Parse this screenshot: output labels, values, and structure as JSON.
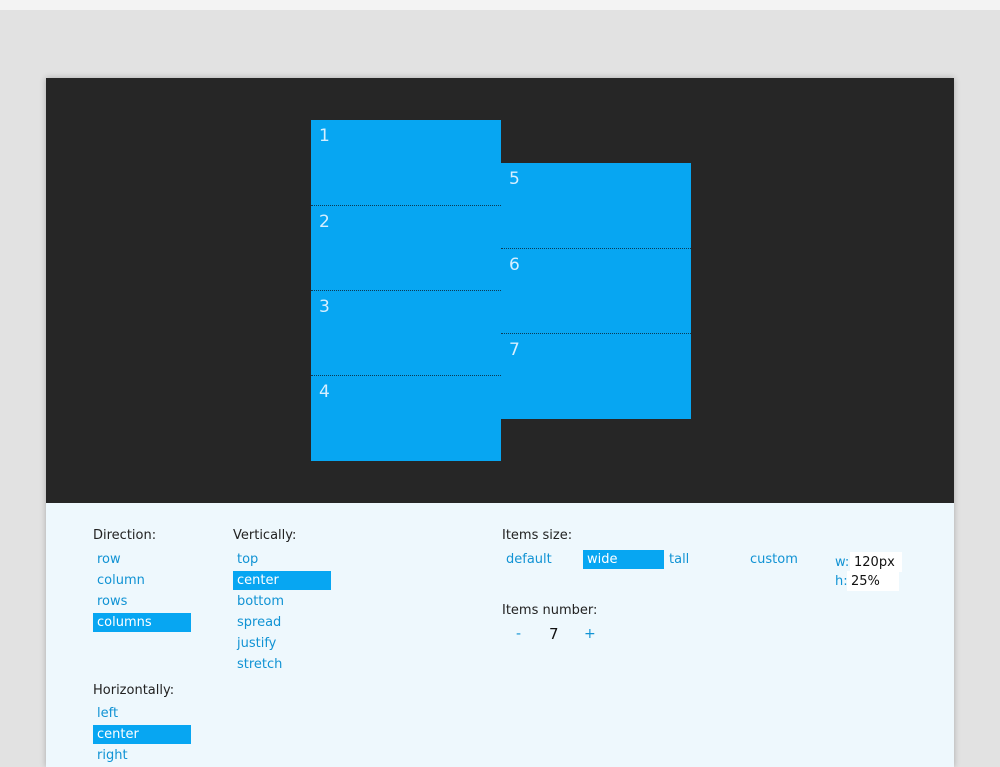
{
  "stage": {
    "items": [
      "1",
      "2",
      "3",
      "4",
      "5",
      "6",
      "7"
    ]
  },
  "direction": {
    "label": "Direction:",
    "options": [
      "row",
      "column",
      "rows",
      "columns"
    ],
    "selected": "columns"
  },
  "vertically": {
    "label": "Vertically:",
    "options": [
      "top",
      "center",
      "bottom",
      "spread",
      "justify",
      "stretch"
    ],
    "selected": "center"
  },
  "horizontally": {
    "label": "Horizontally:",
    "options": [
      "left",
      "center",
      "right"
    ],
    "selected": "center"
  },
  "items_size": {
    "label": "Items size:",
    "options": [
      "default",
      "wide",
      "tall",
      "custom"
    ],
    "selected": "wide",
    "w_label": "w:",
    "w_value": "120px",
    "h_label": "h:",
    "h_value": "25%"
  },
  "items_number": {
    "label": "Items number:",
    "minus": "-",
    "value": "7",
    "plus": "+"
  },
  "colors": {
    "accent": "#07a6f2",
    "link": "#1193d4",
    "stage_bg": "#262626",
    "panel_bg": "#eef8fd"
  }
}
